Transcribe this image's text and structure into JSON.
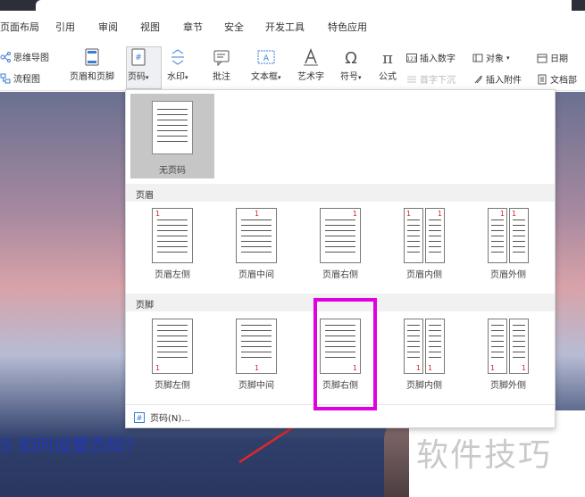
{
  "menu_tabs": [
    "页面布局",
    "引用",
    "审阅",
    "视图",
    "章节",
    "安全",
    "开发工具",
    "特色应用"
  ],
  "ribbon": {
    "mindmap": "思维导图",
    "flowchart": "流程图",
    "header_footer": "页眉和页脚",
    "page_number": "页码",
    "watermark": "水印",
    "comment": "批注",
    "textbox": "文本框",
    "wordart": "艺术字",
    "symbol": "符号",
    "formula": "公式",
    "insert_number": "插入数字",
    "object": "对象",
    "drop_cap": "首字下沉",
    "insert_attachment": "插入附件",
    "date": "日期",
    "doc_part": "文档部"
  },
  "dropdown": {
    "none_label": "无页码",
    "header_section": "页眉",
    "footer_section": "页脚",
    "header_options": [
      "页眉左侧",
      "页眉中间",
      "页眉右侧",
      "页眉内侧",
      "页眉外侧"
    ],
    "footer_options": [
      "页脚左侧",
      "页脚中间",
      "页脚右侧",
      "页脚内侧",
      "页脚外侧"
    ],
    "page_number_item": "页码(N)...",
    "sample_number": "1"
  },
  "document": {
    "caption": "S 如何设置页码?",
    "watermark": "软件技巧"
  },
  "colors": {
    "highlight": "#e000e0",
    "arrow": "#e02828",
    "caption": "#2137b8",
    "page_number": "#d22222"
  }
}
